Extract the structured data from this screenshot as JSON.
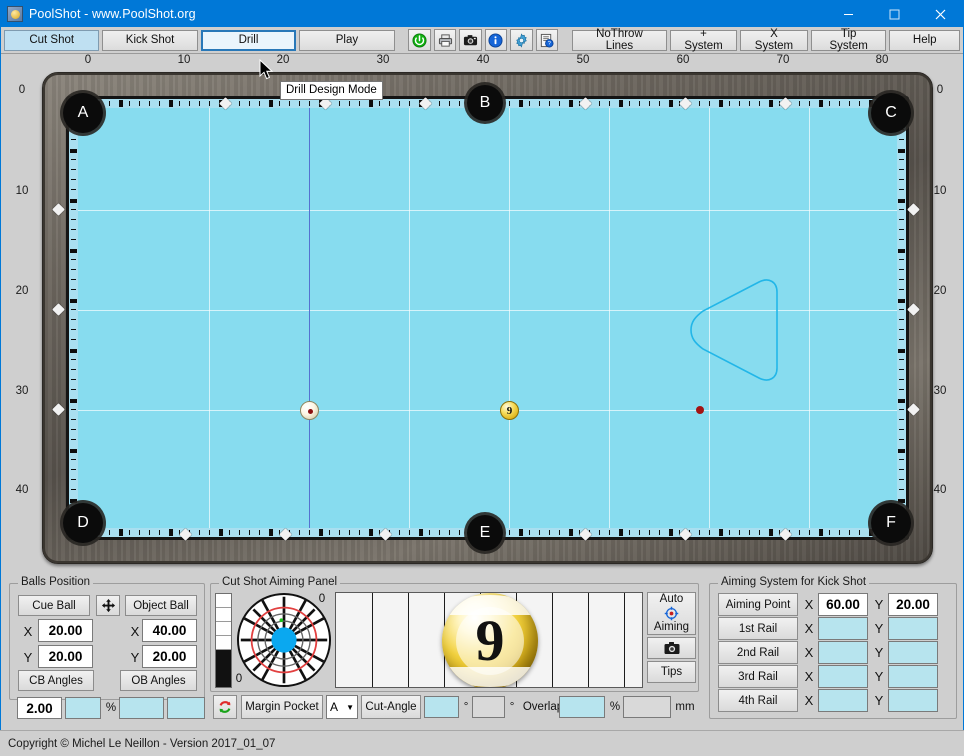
{
  "window": {
    "title": "PoolShot - www.PoolShot.org",
    "icon": "app-icon",
    "minimize": "minimize-icon",
    "maximize": "maximize-icon",
    "close": "close-icon"
  },
  "toolbar": {
    "modes": [
      {
        "label": "Cut Shot",
        "state": "active"
      },
      {
        "label": "Kick Shot",
        "state": "normal"
      },
      {
        "label": "Drill",
        "state": "focused"
      },
      {
        "label": "Play",
        "state": "normal"
      }
    ],
    "icons": [
      {
        "name": "power-icon",
        "title": "power"
      },
      {
        "name": "printer-icon",
        "title": "print"
      },
      {
        "name": "camera-icon",
        "title": "screenshot"
      },
      {
        "name": "info-icon",
        "title": "information"
      },
      {
        "name": "gear-icon",
        "title": "settings"
      },
      {
        "name": "document-help-icon",
        "title": "help document"
      }
    ],
    "systems": [
      {
        "label": "NoThrow Lines"
      },
      {
        "label": "+ System"
      },
      {
        "label": "X System"
      },
      {
        "label": "Tip System"
      },
      {
        "label": "Help"
      }
    ]
  },
  "tooltip": {
    "text": "Drill Design Mode"
  },
  "table": {
    "ruler_top": [
      "0",
      "10",
      "20",
      "30",
      "40",
      "50",
      "60",
      "70",
      "80"
    ],
    "ruler_left": [
      "0",
      "10",
      "20",
      "30",
      "40"
    ],
    "ruler_right": [
      "0",
      "10",
      "20",
      "30",
      "40"
    ],
    "pockets": [
      {
        "label": "A",
        "position": "top-left"
      },
      {
        "label": "B",
        "position": "top-center"
      },
      {
        "label": "C",
        "position": "top-right"
      },
      {
        "label": "D",
        "position": "bottom-left"
      },
      {
        "label": "E",
        "position": "bottom-center"
      },
      {
        "label": "F",
        "position": "bottom-right"
      }
    ],
    "cue_ball": {
      "name": "cue-ball",
      "x": "20.00",
      "y": "20.00"
    },
    "object_ball": {
      "name": "object-ball",
      "number": "9",
      "x": "40.00",
      "y": "20.00"
    },
    "aiming_point": {
      "name": "aiming-point-marker",
      "x": "60.00",
      "y": "20.00"
    },
    "drill_shape": {
      "name": "drill-triangle-shape",
      "color": "#22b6e8"
    },
    "cloth_color": "#87dcef"
  },
  "balls_position": {
    "legend": "Balls Position",
    "cue_ball_button": "Cue Ball",
    "move_icon": "move-arrows-icon",
    "object_ball_button": "Object Ball",
    "cue_x_label": "X",
    "cue_x_value": "20.00",
    "cue_y_label": "Y",
    "cue_y_value": "20.00",
    "obj_x_label": "X",
    "obj_x_value": "40.00",
    "obj_y_label": "Y",
    "obj_y_value": "20.00",
    "cb_angles_button": "CB Angles",
    "ob_angles_button": "OB Angles",
    "cb_angle_value": "2.00",
    "cb_angle_percent": "",
    "percent_label": "%",
    "ob_angle_value_1": "",
    "ob_angle_value_2": ""
  },
  "aiming_panel": {
    "legend": "Cut Shot Aiming Panel",
    "slider_top_label": "",
    "clock_top_label": "0",
    "clock_bottom_label": "0",
    "refresh_icon": "refresh-icon",
    "margin_pocket_button": "Margin Pocket",
    "pocket_select_value": "A",
    "cut_angle_button": "Cut-Angle",
    "cut_angle_value": "",
    "degree_label_1": "°",
    "cut_angle_value_2": "",
    "degree_label_2": "°",
    "overlap_label": "Overlap",
    "overlap_value": "",
    "percent_label": "%",
    "mm_value": "",
    "mm_label": "mm",
    "ball_number": "9",
    "auto_aiming_label_top": "Auto",
    "auto_aiming_label_bottom": "Aiming",
    "auto_aiming_icon": "crosshair-icon",
    "camera_icon": "camera-icon",
    "tips_button": "Tips"
  },
  "kick_panel": {
    "legend": "Aiming System for Kick Shot",
    "x_label": "X",
    "y_label": "Y",
    "rows": [
      {
        "button": "Aiming Point",
        "x": "60.00",
        "y": "20.00",
        "filled": true
      },
      {
        "button": "1st Rail",
        "x": "",
        "y": "",
        "filled": false
      },
      {
        "button": "2nd Rail",
        "x": "",
        "y": "",
        "filled": false
      },
      {
        "button": "3rd Rail",
        "x": "",
        "y": "",
        "filled": false
      },
      {
        "button": "4th Rail",
        "x": "",
        "y": "",
        "filled": false
      }
    ]
  },
  "statusbar": {
    "text": "Copyright © Michel Le Neillon - Version 2017_01_07"
  }
}
